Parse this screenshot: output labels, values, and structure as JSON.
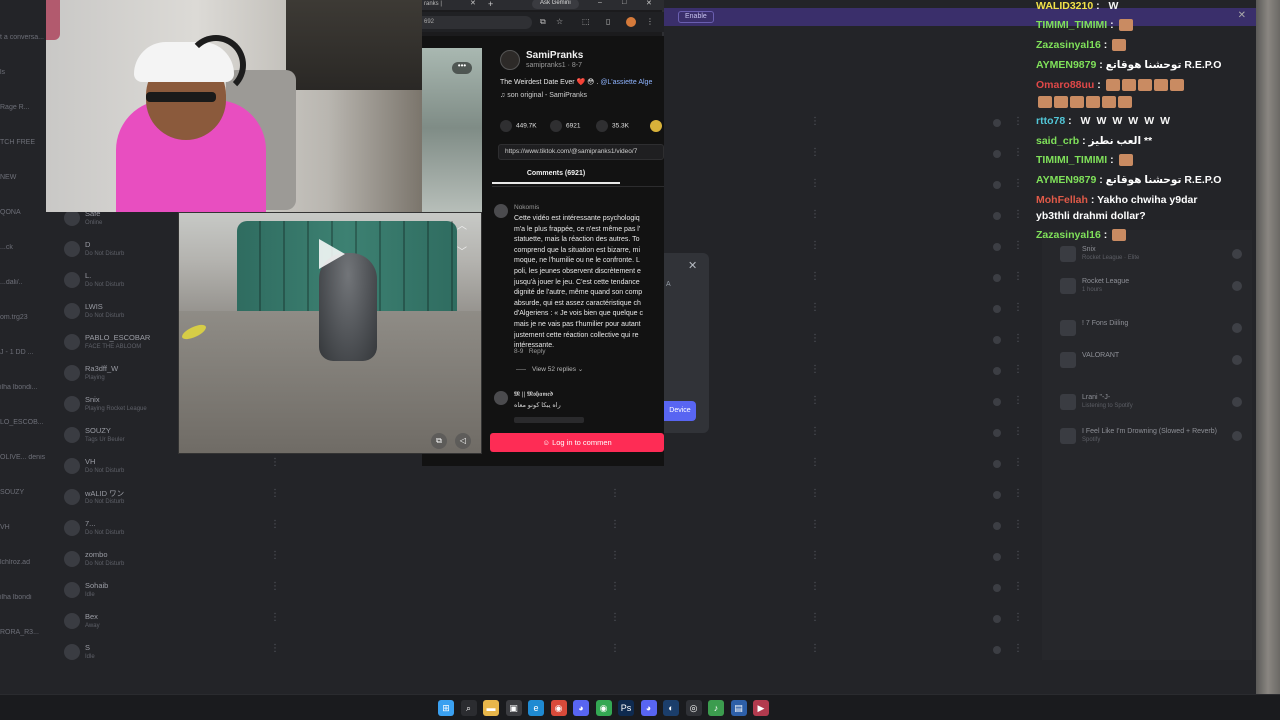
{
  "discord": {
    "top_strip_button": "Enable",
    "left_texts": [
      "t a conversa...",
      "ls",
      "Rage R...",
      "TCH FREE",
      "NEW",
      "QONA",
      "...ck",
      "...dali/..",
      "om.trg23",
      "J - 1 DD ...",
      "ilha lbondi...",
      "LO_ESCOB...",
      "OLIVE... denis",
      "SOUZY",
      "VH",
      "lchlroz.ad",
      "ilha lbondi",
      "RORA_R3..."
    ],
    "members": [
      {
        "name": "Safe",
        "status": "Online"
      },
      {
        "name": "D",
        "status": "Do Not Disturb"
      },
      {
        "name": "L.",
        "status": "Do Not Disturb"
      },
      {
        "name": "LWIS",
        "status": "Do Not Disturb"
      },
      {
        "name": "PABLO_ESCOBAR",
        "status": "FACE THE ABLOOM"
      },
      {
        "name": "Ra3dff_W",
        "status": "Playing"
      },
      {
        "name": "Snix",
        "status": "Playing Rocket League"
      },
      {
        "name": "SOUZY",
        "status": "Tags Ur Beuler"
      },
      {
        "name": "VH",
        "status": "Do Not Disturb"
      },
      {
        "name": "wALID ワン",
        "status": "Do Not Disturb"
      },
      {
        "name": "7...",
        "status": "Do Not Disturb"
      },
      {
        "name": "zombo",
        "status": "Do Not Disturb"
      },
      {
        "name": "Sohaib",
        "status": "Idle"
      },
      {
        "name": "Bex",
        "status": "Away"
      },
      {
        "name": "S",
        "status": "Idle"
      }
    ],
    "activities": [
      {
        "title": "Snix",
        "sub": "Rocket League · Elite"
      },
      {
        "title": "Rocket League",
        "sub": "1 hours"
      },
      {
        "title": "! 7 Fons Diiling",
        "sub": ""
      },
      {
        "title": "VALORANT",
        "sub": ""
      },
      {
        "title": "Lrani \"-J-",
        "sub": "Listening to Spotify"
      },
      {
        "title": "I Feel Like I'm Drowning (Slowed + Reverb)",
        "sub": "Spotify"
      }
    ],
    "dialog": {
      "close": "✕",
      "letter": "A",
      "device_button": "Device"
    }
  },
  "browser": {
    "tab_title": "ranks |",
    "tab_close": "✕",
    "new_tab": "+",
    "gemini_button": "Ask Gemini",
    "address": "692",
    "minimize": "–",
    "maximize": "□",
    "close": "✕",
    "menu": "⋮"
  },
  "tiktok": {
    "author": "SamiPranks",
    "handle_date": "samipranks1 · 8-7",
    "description_text": "The Weirdest Date Ever ❤️ 😳 .",
    "description_tag": "@L'assiette Alge",
    "music": "♫  son original - SamiPranks",
    "likes": "449.7K",
    "comments_count": "6921",
    "saves": "35.3K",
    "link": "https://www.tiktok.com/@samipranks1/video/7",
    "comments_tab": "Comments (6921)",
    "comment_user": "Nokomis",
    "comment_text": "Cette vidéo est intéressante psychologiq\nm'a le plus frappée, ce n'est même pas l'\nstatuette, mais la réaction des autres. To\ncomprend que la situation est bizarre, mi\nmoque, ne l'humilie ou ne le confronte. L\npoli, les jeunes observent discrètement e\njusqu'à jouer le jeu. C'est cette tendance\ndignité de l'autre, même quand son comp\nabsurde, qui est assez caractéristique ch\nd'Algeriens : « Je vois bien que quelque c\nmais je ne vais pas t'humilier pour autant\njustement cette réaction collective qui re\nintéressante.",
    "comment_date": "8-9",
    "comment_reply": "Reply",
    "view_replies": "View 52 replies ⌄",
    "comment2_user": "𝕸 || 𝕸𝖔𝖍𝖆𝖒𝖊𝖉",
    "comment2_text": "راه يبكا كونو معاه",
    "login_button": "Log in to commen",
    "menu_dots": "•••"
  },
  "chat": [
    {
      "user": "WALID3210",
      "color": "#f2e24a",
      "msg": "",
      "w": 1,
      "emotes": 0
    },
    {
      "user": "TIMIMI_TIMIMI",
      "color": "#7fe05a",
      "msg": "",
      "w": 0,
      "emotes": 1
    },
    {
      "user": "Zazasinyal16",
      "color": "#7fe05a",
      "msg": "",
      "w": 0,
      "emotes": 1
    },
    {
      "user": "AYMEN9879",
      "color": "#7fe05a",
      "msg": "توحشنا هوقاتع R.E.P.O",
      "w": 0,
      "emotes": 0
    },
    {
      "user": "Omaro88uu",
      "color": "#e04848",
      "msg": "",
      "w": 0,
      "emotes": 5
    },
    {
      "user": "",
      "color": "#e04848",
      "msg": "",
      "w": 0,
      "emotes": 6
    },
    {
      "user": "rtto78",
      "color": "#52c7d8",
      "msg": "",
      "w": 6,
      "emotes": 0
    },
    {
      "user": "said_crb",
      "color": "#7fe05a",
      "msg": "العب نطيز **",
      "w": 0,
      "emotes": 0
    },
    {
      "user": "TIMIMI_TIMIMI",
      "color": "#7fe05a",
      "msg": "",
      "w": 0,
      "emotes": 1
    },
    {
      "user": "AYMEN9879",
      "color": "#7fe05a",
      "msg": "توحشنا هوقاتع R.E.P.O",
      "w": 0,
      "emotes": 0
    },
    {
      "user": "MohFellah",
      "color": "#e05a48",
      "msg": "Yakho chwiha y9dar",
      "w": 0,
      "emotes": 0
    },
    {
      "user": "",
      "color": "#ffffff",
      "msg": "yb3thli drahmi dollar?",
      "w": 0,
      "emotes": 0
    },
    {
      "user": "Zazasinyal16",
      "color": "#7fe05a",
      "msg": "",
      "w": 0,
      "emotes": 1
    }
  ],
  "taskbar": {
    "icons": [
      {
        "name": "windows-start-icon",
        "color": "#3aa0f0",
        "glyph": "⊞"
      },
      {
        "name": "search-icon",
        "color": "#2b2c30",
        "glyph": "⌕"
      },
      {
        "name": "file-explorer-icon",
        "color": "#e8b64a",
        "glyph": "▬"
      },
      {
        "name": "store-icon",
        "color": "#3b3c40",
        "glyph": "▣"
      },
      {
        "name": "edge-icon",
        "color": "#1f8ad2",
        "glyph": "e"
      },
      {
        "name": "chrome-icon",
        "color": "#d94a3a",
        "glyph": "◉"
      },
      {
        "name": "discord-icon",
        "color": "#5865f2",
        "glyph": "◕"
      },
      {
        "name": "chrome-active-icon",
        "color": "#34a853",
        "glyph": "◉"
      },
      {
        "name": "photoshop-icon",
        "color": "#0e2a4f",
        "glyph": "Ps"
      },
      {
        "name": "discord-alt-icon",
        "color": "#5865f2",
        "glyph": "◕"
      },
      {
        "name": "steam-icon",
        "color": "#1b3e6b",
        "glyph": "◐"
      },
      {
        "name": "obs-icon",
        "color": "#2f3136",
        "glyph": "◎"
      },
      {
        "name": "spotify-icon",
        "color": "#3c9c4e",
        "glyph": "♪"
      },
      {
        "name": "app-icon",
        "color": "#2d5fa8",
        "glyph": "▤"
      },
      {
        "name": "media-player-icon",
        "color": "#b23a4e",
        "glyph": "▶"
      }
    ]
  }
}
